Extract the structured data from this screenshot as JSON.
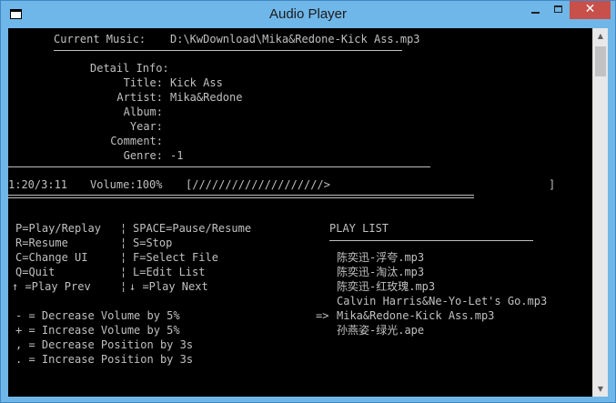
{
  "window": {
    "title": "Audio Player",
    "close_glyph": "✕",
    "scroll_up_glyph": "▲",
    "scroll_down_glyph": "▼"
  },
  "now_playing": {
    "label": "Current Music:",
    "path": "D:\\KwDownload\\Mika&Redone-Kick Ass.mp3"
  },
  "details": {
    "header": "Detail Info:",
    "fields": [
      {
        "label": "Title:",
        "value": "Kick Ass"
      },
      {
        "label": "Artist:",
        "value": "Mika&Redone"
      },
      {
        "label": "Album:",
        "value": ""
      },
      {
        "label": "Year:",
        "value": ""
      },
      {
        "label": "Comment:",
        "value": ""
      },
      {
        "label": "Genre:",
        "value": "-1"
      }
    ]
  },
  "status": {
    "time": "1:20/3:11",
    "volume": "Volume:100%",
    "progress_bar": "[////////////////////>",
    "progress_end": "]",
    "progress": 0.42
  },
  "help": {
    "rows": [
      {
        "left": "P=Play/Replay",
        "right": "SPACE=Pause/Resume"
      },
      {
        "left": "R=Resume",
        "right": "S=Stop"
      },
      {
        "left": "C=Change UI",
        "right": "F=Select File"
      },
      {
        "left": "Q=Quit",
        "right": "L=Edit List"
      },
      {
        "left": "↑ =Play Prev",
        "right": "↓ =Play Next"
      }
    ],
    "separator": "¦",
    "extra": [
      "- = Decrease Volume by 5%",
      "+ = Increase Volume by 5%",
      ", = Decrease Position by 3s",
      ". = Increase Position by 3s"
    ]
  },
  "playlist": {
    "header": "PLAY LIST",
    "current_marker": "=>",
    "current_index": 4,
    "items": [
      "陈奕迅-浮夸.mp3",
      "陈奕迅-淘汰.mp3",
      "陈奕迅-红玫瑰.mp3",
      "Calvin Harris&Ne-Yo-Let's Go.mp3",
      "Mika&Redone-Kick Ass.mp3",
      "孙燕姿-绿光.ape"
    ]
  },
  "colors": {
    "console_bg": "#000000",
    "console_text": "#c0c0c0",
    "titlebar": "#6fb6e9",
    "close_button": "#c7504a"
  }
}
